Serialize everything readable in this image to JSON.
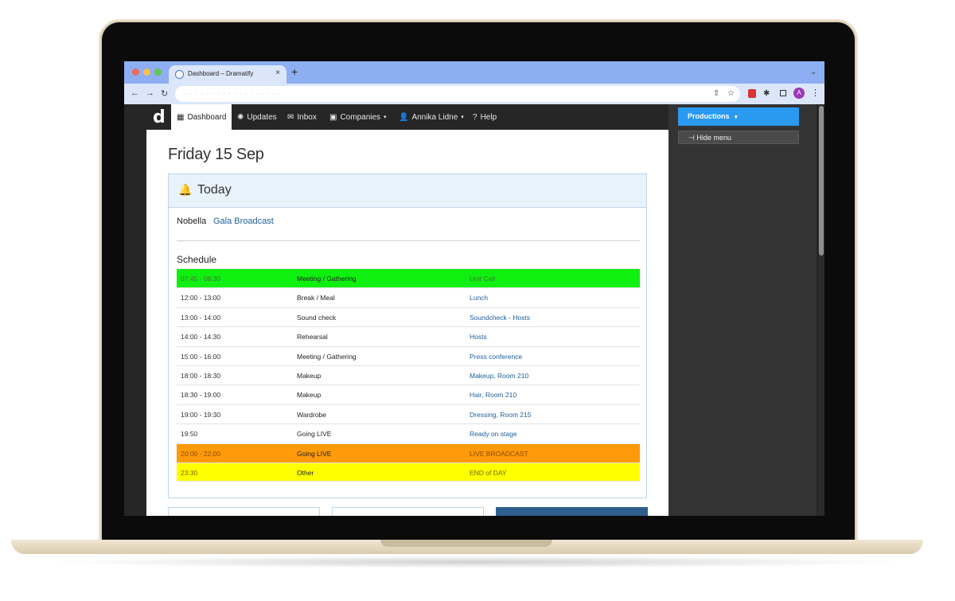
{
  "browser": {
    "tab_title": "Dashboard – Dramatify",
    "tab_close": "×",
    "new_tab": "+",
    "tab_menu": "⌄",
    "avatar_initial": "A",
    "nav_back": "←",
    "nav_forward": "→",
    "nav_reload": "↻",
    "share_icon": "⇧",
    "star_icon": "☆",
    "puzzle_icon": "✱",
    "kebab": "⋮"
  },
  "app": {
    "logo": "d",
    "nav": [
      {
        "label": "Dashboard",
        "icon": "▦"
      },
      {
        "label": "Updates",
        "icon": "✺"
      },
      {
        "label": "Inbox",
        "icon": "✉"
      },
      {
        "label": "Companies",
        "icon": "▣"
      },
      {
        "label": "Annika Lidne",
        "icon": "👤"
      },
      {
        "label": "Help",
        "icon": "?"
      }
    ],
    "caret": "▾"
  },
  "sidebar": {
    "productions_label": "Productions",
    "productions_caret": "▾",
    "hide_menu_icon": "⊣",
    "hide_menu_label": "Hide menu"
  },
  "main": {
    "date_title": "Friday 15 Sep",
    "today_label": "Today",
    "bell_icon": "🔔",
    "artist": "Nobella",
    "show_link": "Gala Broadcast",
    "schedule_label": "Schedule"
  },
  "schedule": [
    {
      "time": "07:45 - 08:30",
      "type": "Meeting / Gathering",
      "detail": "Unit Call",
      "color": "#10f010"
    },
    {
      "time": "12:00 - 13:00",
      "type": "Break / Meal",
      "detail": "Lunch",
      "color": "#ffffff"
    },
    {
      "time": "13:00 - 14:00",
      "type": "Sound check",
      "detail": "Soundcheck - Hosts",
      "color": "#ffffff"
    },
    {
      "time": "14:00 - 14:30",
      "type": "Rehearsal",
      "detail": "Hosts",
      "color": "#ffffff"
    },
    {
      "time": "15:00 - 16:00",
      "type": "Meeting / Gathering",
      "detail": "Press conference",
      "color": "#ffffff"
    },
    {
      "time": "18:00 - 18:30",
      "type": "Makeup",
      "detail": "Makeup, Room 210",
      "color": "#ffffff"
    },
    {
      "time": "18:30 - 19:00",
      "type": "Makeup",
      "detail": "Hair, Room 210",
      "color": "#ffffff"
    },
    {
      "time": "19:00 - 19:30",
      "type": "Wardrobe",
      "detail": "Dressing, Room 215",
      "color": "#ffffff"
    },
    {
      "time": "19:50",
      "type": "Going LIVE",
      "detail": "Ready on stage",
      "color": "#ffffff"
    },
    {
      "time": "20:00 - 22:00",
      "type": "Going LIVE",
      "detail": "LIVE BROADCAST",
      "color": "#ff9a09"
    },
    {
      "time": "23:30",
      "type": "Other",
      "detail": "END of DAY",
      "color": "#ffff00"
    }
  ],
  "colors": {
    "accent": "#2a9af0",
    "link": "#1e5e9a",
    "nav_bg": "#262626"
  }
}
